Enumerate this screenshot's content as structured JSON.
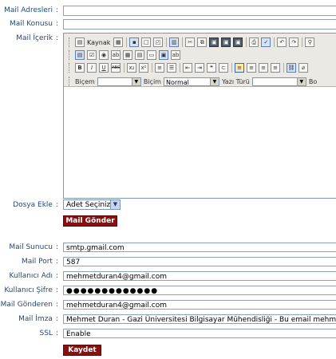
{
  "mail_form": {
    "addresses_label": "Mail Adresleri",
    "subject_label": "Mail Konusu",
    "content_label": "Mail İçerik",
    "attach_label": "Dosya Ekle",
    "attach_select": "Adet Seçiniz...",
    "send_button": "Mail Gönder"
  },
  "editor": {
    "source_label": "Kaynak",
    "format_label": "Biçem",
    "style_label": "Biçim",
    "style_value": "Normal",
    "font_label": "Yazı Türü",
    "size_label": "Bo",
    "bold": "B",
    "italic": "I",
    "underline": "U",
    "strike": "ABC",
    "subscript": "x₂",
    "superscript": "x²"
  },
  "settings": {
    "server_label": "Mail Sunucu",
    "server_value": "smtp.gmail.com",
    "port_label": "Mail Port",
    "port_value": "587",
    "user_label": "Kullanıcı Adı",
    "user_value": "mehmetduran4@gmail.com",
    "password_label": "Kullanıcı Şifre",
    "password_value": "●●●●●●●●●●●●●",
    "sender_label": "Mail Gönderen",
    "sender_value": "mehmetduran4@gmail.com",
    "signature_label": "Mail İmza",
    "signature_value": "Mehmet Duran - Gazi Üniversitesi Bilgisayar Mühendisliği  - Bu email mehmetdura",
    "ssl_label": "SSL",
    "ssl_value": "Enable",
    "save_button": "Kaydet"
  },
  "colors": {
    "button_bg": "#8b0f0f",
    "label_text": "#234a7a"
  }
}
